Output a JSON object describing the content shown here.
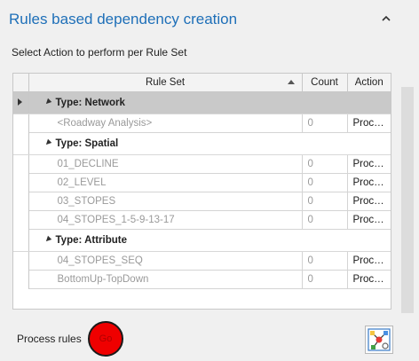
{
  "panel": {
    "title": "Rules based dependency creation",
    "subtitle": "Select Action to perform per Rule Set"
  },
  "grid": {
    "columns": {
      "rule_set": "Rule Set",
      "count": "Count",
      "action": "Action"
    },
    "groups": [
      {
        "label": "Type: Network",
        "rows": [
          {
            "name": "<Roadway Analysis>",
            "count": "0",
            "action": "Process"
          }
        ]
      },
      {
        "label": "Type: Spatial",
        "rows": [
          {
            "name": "01_DECLINE",
            "count": "0",
            "action": "Process"
          },
          {
            "name": "02_LEVEL",
            "count": "0",
            "action": "Process"
          },
          {
            "name": "03_STOPES",
            "count": "0",
            "action": "Process"
          },
          {
            "name": "04_STOPES_1-5-9-13-17",
            "count": "0",
            "action": "Process"
          }
        ]
      },
      {
        "label": "Type: Attribute",
        "rows": [
          {
            "name": "04_STOPES_SEQ",
            "count": "0",
            "action": "Process"
          },
          {
            "name": "BottomUp-TopDown",
            "count": "0",
            "action": "Process"
          }
        ]
      }
    ]
  },
  "footer": {
    "process_label": "Process rules",
    "go_label": "Go"
  },
  "colors": {
    "title": "#1e6fb8",
    "go_button": "#ef0000",
    "selected_group": "#c9c9c9"
  },
  "icons": {
    "collapse": "chevron-up-icon",
    "tool": "dependency-tool-icon"
  }
}
